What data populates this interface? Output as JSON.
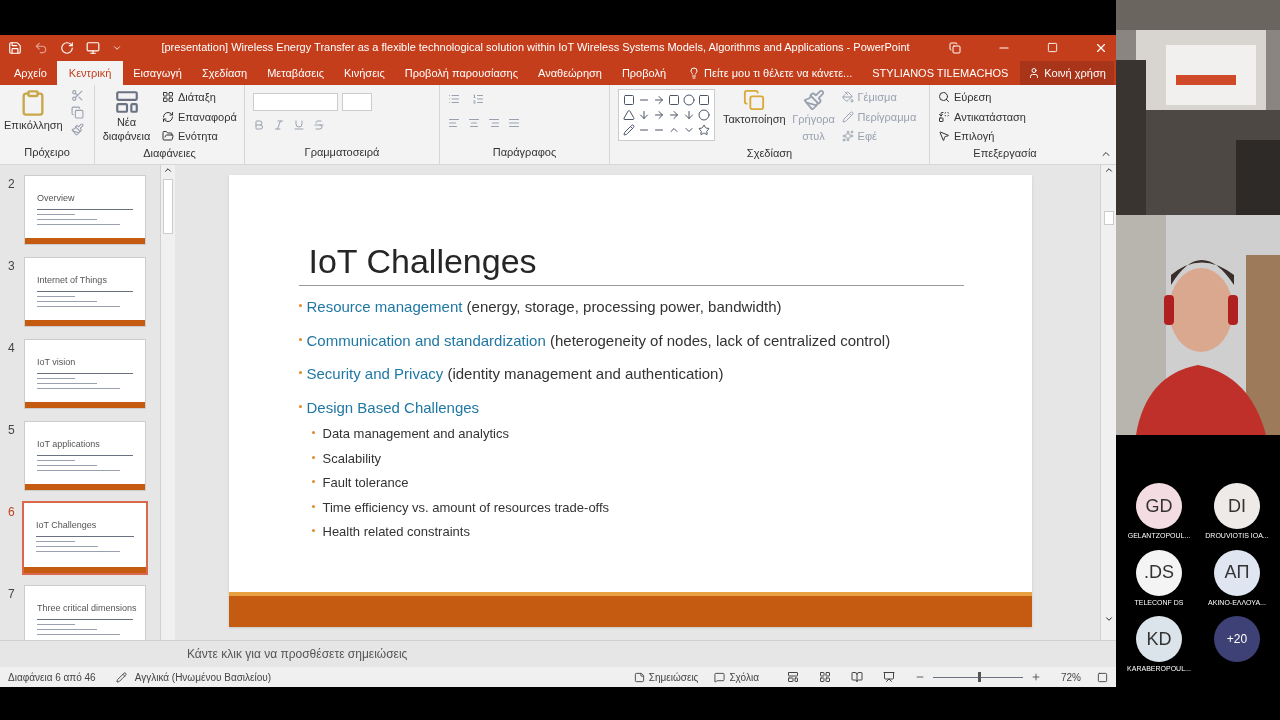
{
  "title_bar": {
    "title": "[presentation] Wireless Energy Transfer as a flexible technological solution within IoT Wireless Systems Models, Algorithms and Applications - PowerPoint"
  },
  "ribbon_tabs": [
    {
      "label": "Αρχείο",
      "selected": false
    },
    {
      "label": "Κεντρική",
      "selected": true
    },
    {
      "label": "Εισαγωγή",
      "selected": false
    },
    {
      "label": "Σχεδίαση",
      "selected": false
    },
    {
      "label": "Μεταβάσεις",
      "selected": false
    },
    {
      "label": "Κινήσεις",
      "selected": false
    },
    {
      "label": "Προβολή παρουσίασης",
      "selected": false
    },
    {
      "label": "Αναθεώρηση",
      "selected": false
    },
    {
      "label": "Προβολή",
      "selected": false
    }
  ],
  "tell_me": "Πείτε μου τι θέλετε να κάνετε...",
  "user": "STYLIANOS TILEMACHOS",
  "share": "Κοινή χρήση",
  "ribbon_groups": {
    "clipboard": {
      "label": "Πρόχειρο",
      "paste": "Επικόλληση"
    },
    "slides": {
      "label": "Διαφάνειες",
      "new_slide": "Νέα διαφάνεια",
      "items": [
        "Διάταξη",
        "Επαναφορά",
        "Ενότητα"
      ]
    },
    "font": {
      "label": "Γραμματοσειρά"
    },
    "paragraph": {
      "label": "Παράγραφος"
    },
    "drawing": {
      "label": "Σχεδίαση",
      "arrange": "Τακτοποίηση",
      "quick_styles": {
        "label": "Γρήγορα στυλ",
        "disabled": true
      },
      "items": [
        {
          "label": "Γέμισμα",
          "disabled": true
        },
        {
          "label": "Περίγραμμα",
          "disabled": true
        },
        {
          "label": "Εφέ",
          "disabled": true
        }
      ]
    },
    "editing": {
      "label": "Επεξεργασία",
      "items": [
        "Εύρεση",
        "Αντικατάσταση",
        "Επιλογή"
      ]
    }
  },
  "thumbnails": [
    {
      "number": "2",
      "title": "Overview",
      "selected": false
    },
    {
      "number": "3",
      "title": "Internet of Things",
      "selected": false
    },
    {
      "number": "4",
      "title": "IoT vision",
      "selected": false
    },
    {
      "number": "5",
      "title": "IoT applications",
      "selected": false
    },
    {
      "number": "6",
      "title": "IoT Challenges",
      "selected": true
    },
    {
      "number": "7",
      "title": "Three critical dimensions",
      "selected": false
    }
  ],
  "slide": {
    "title": "IoT Challenges",
    "bullets": [
      {
        "highlight": "Resource management",
        "rest": " (energy, storage, processing power, bandwidth)"
      },
      {
        "highlight": "Communication and standardization",
        "rest": " (heterogeneity of nodes, lack of centralized control)"
      },
      {
        "highlight": "Security and Privacy",
        "rest": " (identity management and authentication)"
      },
      {
        "highlight": "Design Based Challenges",
        "children": [
          "Data management and analytics",
          "Scalability",
          "Fault tolerance",
          "Time efficiency vs. amount of resources trade-offs",
          "Health related constraints"
        ]
      }
    ]
  },
  "notes_placeholder": "Κάντε κλικ για να προσθέσετε σημειώσεις",
  "status_bar": {
    "slide_info": "Διαφάνεια 6 από 46",
    "language": "Αγγλικά (Ηνωμένου Βασιλείου)",
    "notes": "Σημειώσεις",
    "comments": "Σχόλια",
    "zoom": "72%",
    "zoom_slider": {
      "level": 0.5
    }
  },
  "participants": [
    {
      "initials": "GD",
      "name": "GELANTZOPOUL...",
      "color": "#f3dde2"
    },
    {
      "initials": "DI",
      "name": "DROUVIOTIS IOA...",
      "color": "#eeeae8"
    },
    {
      "initials": ".DS",
      "name": "TELECONF DS",
      "color": "#f4f4f4"
    },
    {
      "initials": "ΑΠ",
      "name": "AKINO-ΕΛΛΟΥΑ...",
      "color": "#dfe6f2"
    },
    {
      "initials": "KD",
      "name": "KARABEROPOUL...",
      "color": "#dbe4ea"
    }
  ],
  "more_participants": "+20"
}
